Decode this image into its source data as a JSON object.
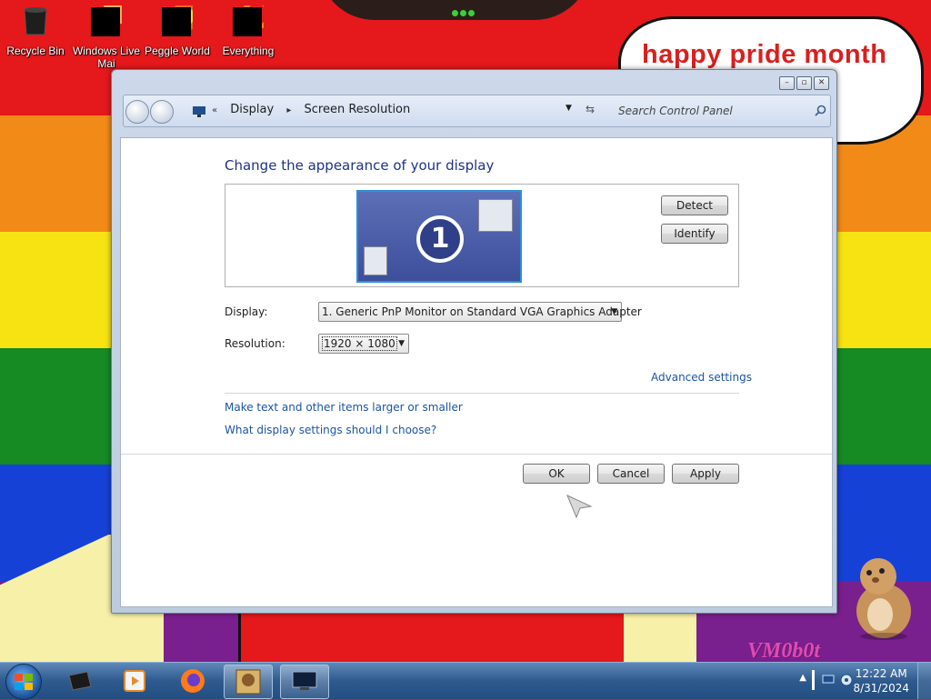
{
  "desktop": {
    "icons": [
      {
        "label": "Recycle Bin",
        "icon": "recycle-bin-icon"
      },
      {
        "label": "Windows Live Mai",
        "icon": "windows-live-mail-icon"
      },
      {
        "label": "Peggle World",
        "icon": "peggle-icon"
      },
      {
        "label": "Everything",
        "icon": "everything-icon"
      }
    ],
    "bubble_text": "happy pride month",
    "watermark": "VM0b0t"
  },
  "window": {
    "breadcrumb": {
      "separator": "«",
      "items": [
        "Display",
        "Screen Resolution"
      ]
    },
    "search": {
      "placeholder": "Search Control Panel"
    },
    "heading": "Change the appearance of your display",
    "monitor_number": "1",
    "buttons": {
      "detect": "Detect",
      "identify": "Identify",
      "ok": "OK",
      "cancel": "Cancel",
      "apply": "Apply"
    },
    "display": {
      "label": "Display:",
      "value": "1. Generic PnP Monitor on Standard VGA Graphics Adapter"
    },
    "resolution": {
      "label": "Resolution:",
      "value": "1920 × 1080"
    },
    "links": {
      "advanced": "Advanced settings",
      "larger": "Make text and other items larger or smaller",
      "help": "What display settings should I choose?"
    }
  },
  "taskbar": {
    "pinned": [
      "media-center-icon",
      "media-player-icon",
      "firefox-icon",
      "sandbox-icon",
      "display-settings-icon"
    ],
    "time": "12:22 AM",
    "date": "8/31/2024"
  },
  "colors": {
    "heading": "#1e3287",
    "link": "#1a55a6",
    "bubble_text": "#d91f1f"
  }
}
